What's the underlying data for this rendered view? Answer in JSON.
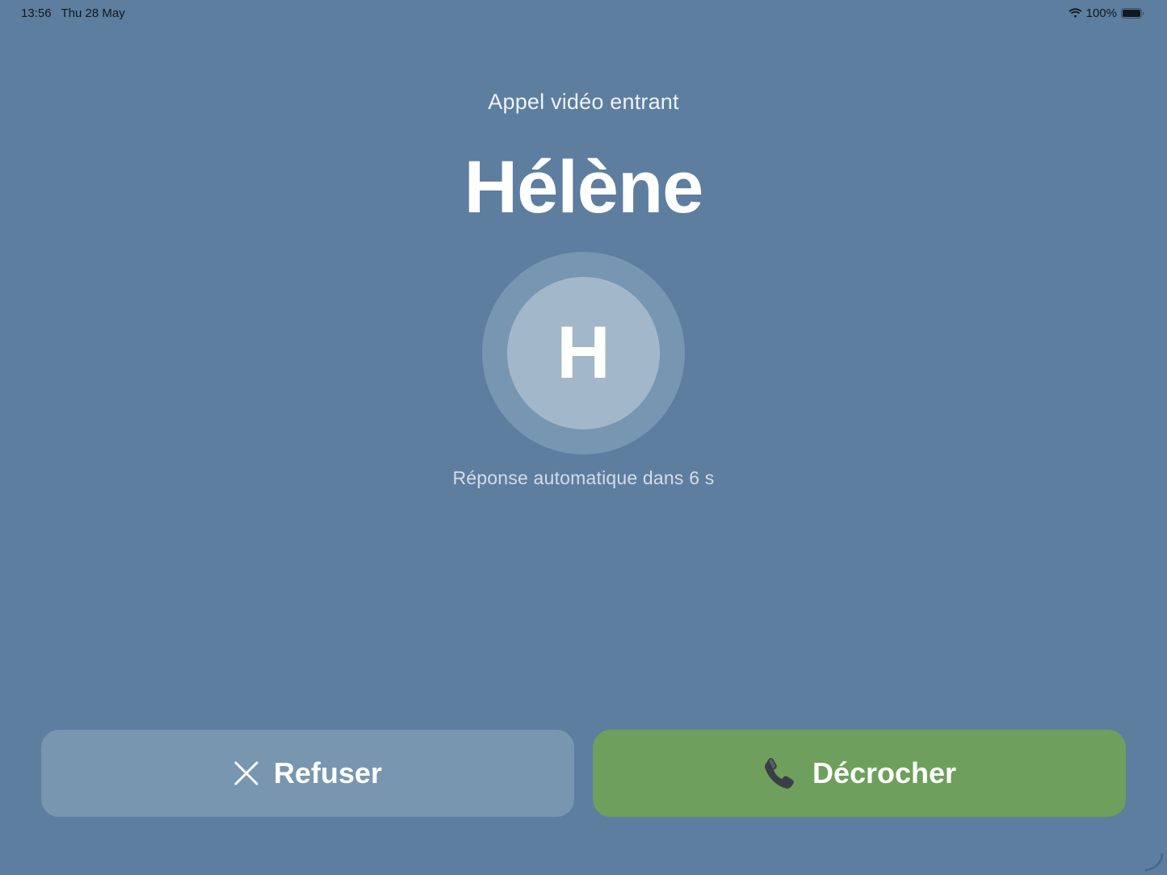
{
  "status_bar": {
    "time": "13:56",
    "date": "Thu 28 May",
    "battery": "100%",
    "wifi_icon": "wifi-icon",
    "battery_icon": "battery-full-icon"
  },
  "call": {
    "label": "Appel vidéo entrant",
    "caller_name": "Hélène",
    "avatar_initial": "H",
    "auto_answer_text": "Réponse automatique dans 6 s"
  },
  "actions": {
    "decline_label": "Refuser",
    "decline_icon": "close-icon",
    "accept_label": "Décrocher",
    "accept_icon": "phone-icon"
  },
  "colors": {
    "background": "#5d7e9f",
    "avatar_ring": "#7796b2",
    "avatar_fill": "#a3b7cb",
    "decline_button": "#7896b0",
    "accept_button": "#6e9f5c"
  }
}
